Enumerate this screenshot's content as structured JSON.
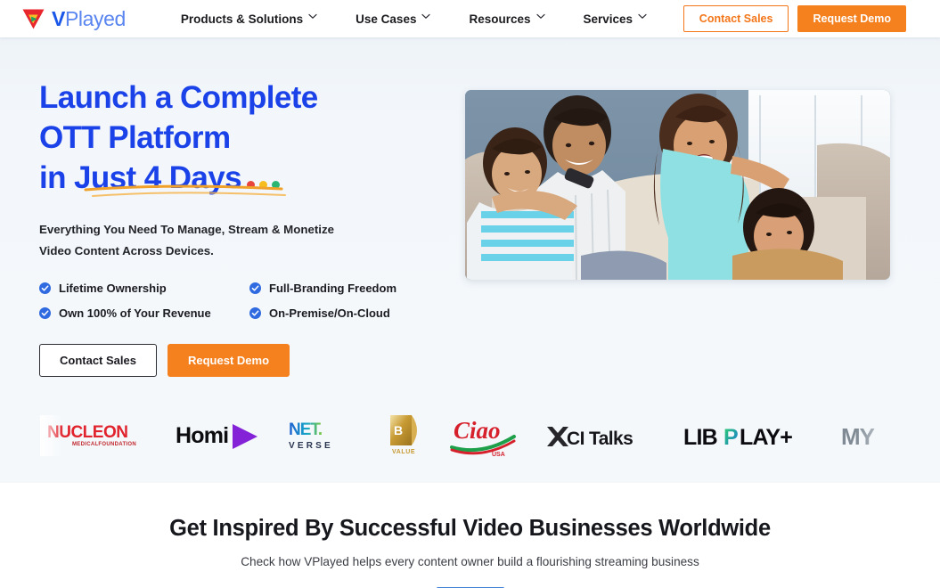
{
  "header": {
    "logo": {
      "mark": "triangle-play-logo",
      "text_bold": "V",
      "text_light": "Played"
    },
    "nav": [
      {
        "label": "Products & Solutions",
        "icon": "chevron-down-icon"
      },
      {
        "label": "Use Cases",
        "icon": "chevron-down-icon"
      },
      {
        "label": "Resources",
        "icon": "chevron-down-icon"
      },
      {
        "label": "Services",
        "icon": "chevron-down-icon"
      }
    ],
    "contact_sales": "Contact Sales",
    "request_demo": "Request Demo",
    "accent_orange": "#f4801e"
  },
  "hero": {
    "headline_lines": [
      "Launch a Complete",
      "OTT Platform",
      "in Just 4 Days"
    ],
    "headline_color": "#1a42e8",
    "underline_color": "#f0a12a",
    "dots": [
      "#e8453c",
      "#f6bd1c",
      "#2bb573"
    ],
    "subhead_lines": [
      "Everything You Need To Manage, Stream & Monetize",
      "Video Content Across Devices."
    ],
    "features": [
      "Lifetime Ownership",
      "Full-Branding Freedom",
      "Own 100% of Your Revenue",
      "On-Premise/On-Cloud"
    ],
    "feature_icon": "check-circle-icon",
    "contact_sales": "Contact Sales",
    "request_demo": "Request Demo",
    "image_alt": "family-watching-tv-photo"
  },
  "logo_strip": {
    "brands": [
      {
        "name": "NUCLEON",
        "sub": "MEDICAL FOUNDATION"
      },
      {
        "name": "Homi",
        "icon": "play-triangle-icon"
      },
      {
        "name": "NET.",
        "sub": "V E R S E"
      },
      {
        "name": "B",
        "sub": "VALUE"
      },
      {
        "name": "Ciao",
        "sub": "USA"
      },
      {
        "name": "XCI Talks",
        "icon": "x-mark-icon"
      },
      {
        "name": "LIBPLAY+"
      },
      {
        "name": "MY"
      }
    ]
  },
  "section2": {
    "title": "Get Inspired By Successful Video Businesses Worldwide",
    "subtitle": "Check how VPlayed helps every content owner build a flourishing streaming business",
    "rule_color": "#3f7fd4"
  }
}
